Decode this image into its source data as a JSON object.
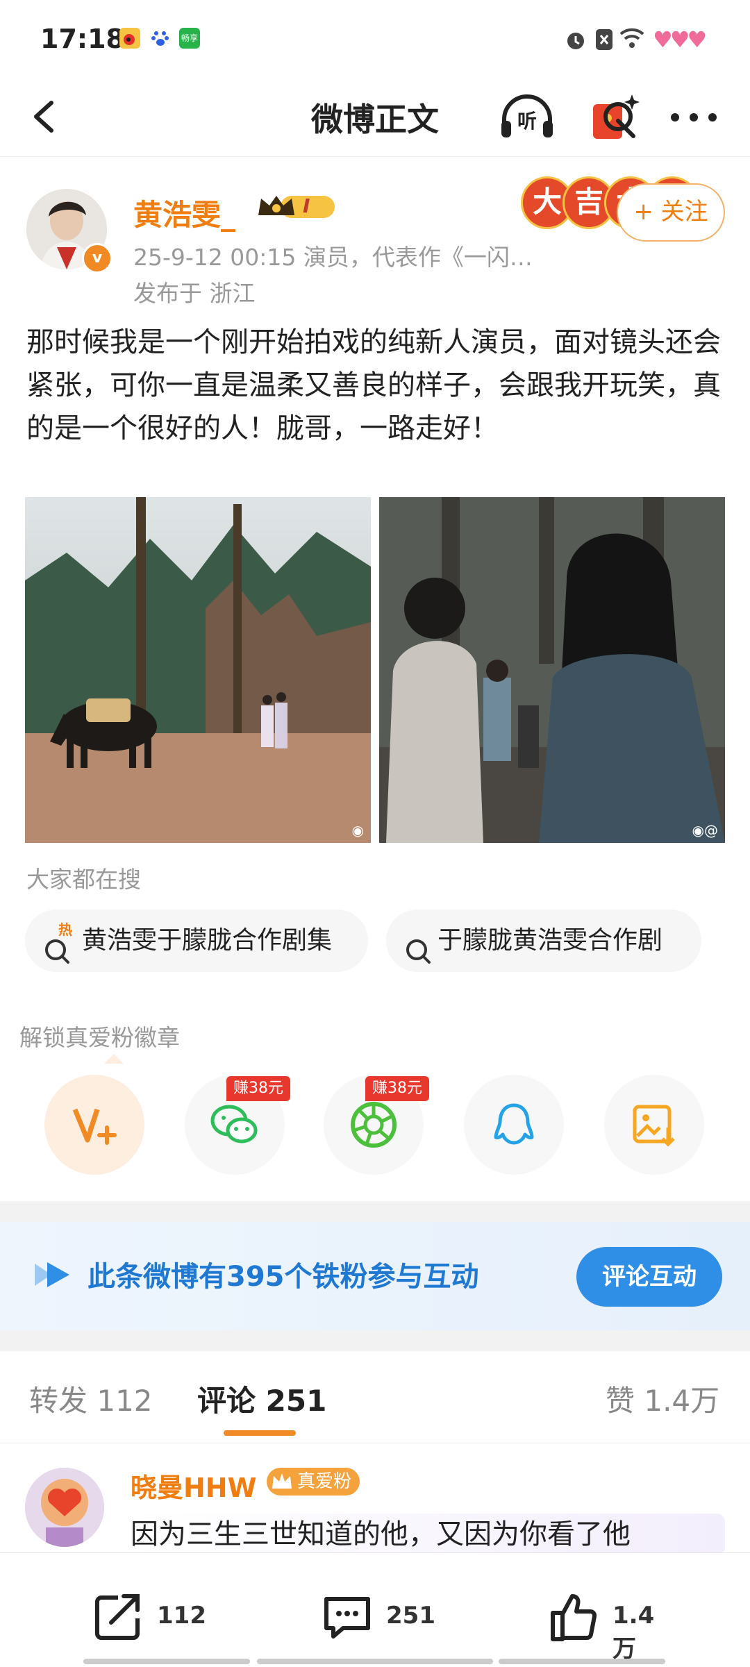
{
  "status_bar": {
    "time": "17:18",
    "notif_icon_text": "畅享"
  },
  "nav": {
    "title": "微博正文",
    "listen_label": "听"
  },
  "author": {
    "name": "黄浩雯_",
    "level_badge": "I",
    "meta": "25-9-12 00:15  演员，代表作《一闪…",
    "source": "发布于 浙江",
    "verified_mark": "v"
  },
  "lucky_badges": [
    "大",
    "吉",
    "大",
    "吉"
  ],
  "follow_label": "+ 关注",
  "post": {
    "text": "那时候我是一个刚开始拍戏的纯新人演员，面对镜头还会紧张，可你一直是温柔又善良的样子，会跟我开玩笑，真的是一个很好的人！胧哥，一路走好！"
  },
  "search_section": {
    "label": "大家都在搜",
    "chips": [
      "黄浩雯于朦胧合作剧集",
      "于朦胧黄浩雯合作剧"
    ],
    "hot_mark": "热"
  },
  "share_section": {
    "label": "解锁真爱粉徽章",
    "earn_badges": [
      "赚38元",
      "赚38元"
    ],
    "colors": {
      "weibo": "#f08a24",
      "wechat": "#2ebd5b",
      "moments": "#4cbf3c",
      "qq": "#25a3e6",
      "save": "#f5a623"
    }
  },
  "fans_banner": {
    "text": "此条微博有395个铁粉参与互动",
    "button": "评论互动"
  },
  "tabs": {
    "repost": "转发 112",
    "comments": "评论 251",
    "likes": "赞 1.4万"
  },
  "comment": {
    "name": "晓曼HHW",
    "badge": "真爱粉",
    "text": "因为三生三世知道的他，又因为你看了他"
  },
  "bottom_bar": {
    "repost_count": "112",
    "comment_count": "251",
    "like_count": "1.4万"
  },
  "accent": "#f08a24"
}
